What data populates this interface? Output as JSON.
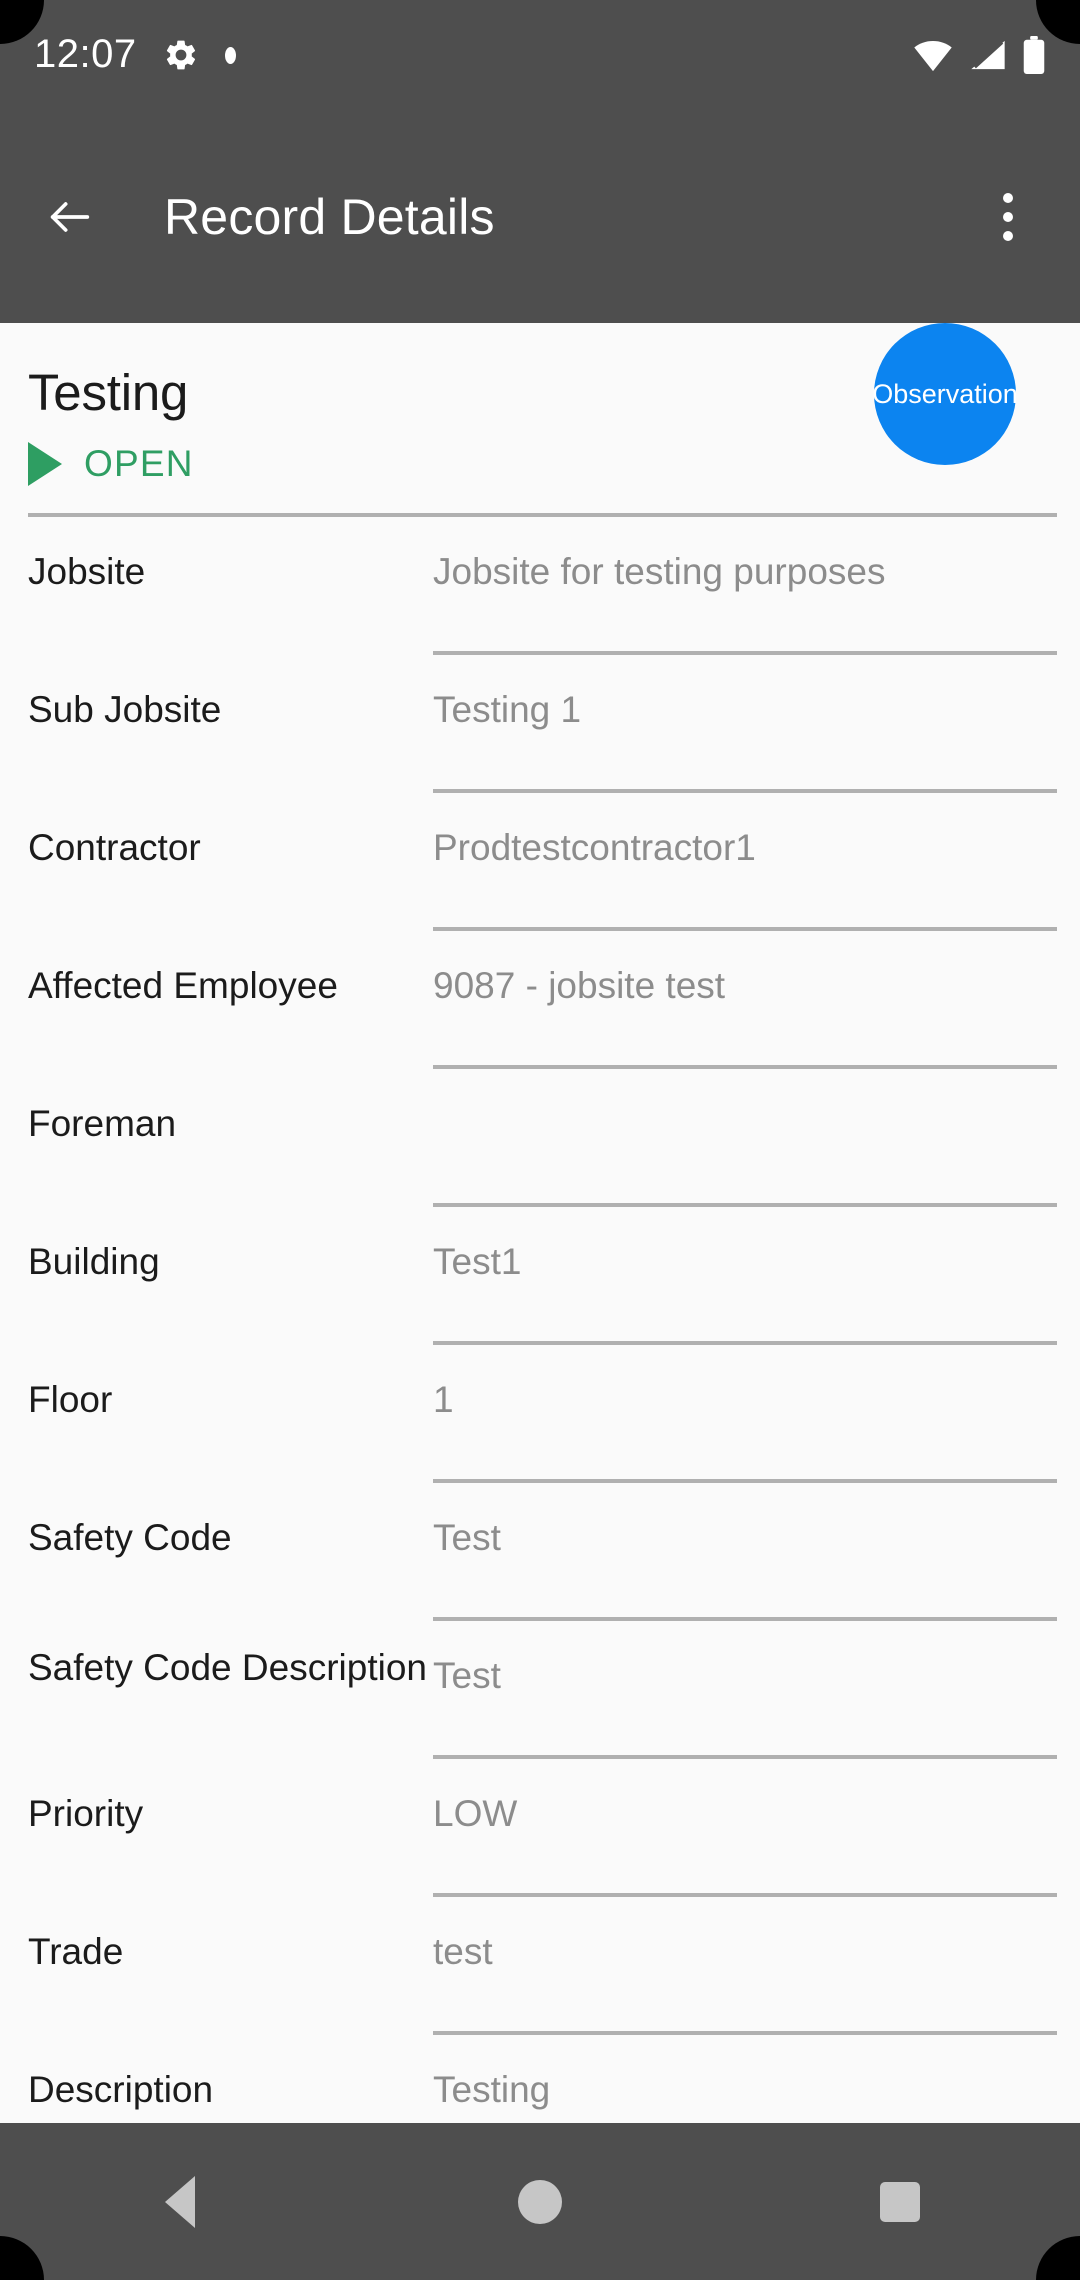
{
  "status_bar": {
    "time": "12:07",
    "icons_left": [
      "gear-icon",
      "dot-icon"
    ],
    "icons_right": [
      "wifi-icon",
      "cell-signal-icon",
      "battery-icon"
    ]
  },
  "app_bar": {
    "back_label": "Back",
    "title": "Record Details",
    "overflow_label": "More options"
  },
  "record": {
    "name": "Testing",
    "status": "OPEN",
    "status_color": "#2f9e63",
    "type_badge": "Observation",
    "type_badge_color": "#0c84f0"
  },
  "fields": [
    {
      "label": "Jobsite",
      "value": "Jobsite for testing purposes"
    },
    {
      "label": "Sub Jobsite",
      "value": "Testing 1"
    },
    {
      "label": "Contractor",
      "value": "Prodtestcontractor1"
    },
    {
      "label": "Affected Employee",
      "value": "9087 - jobsite test"
    },
    {
      "label": "Foreman",
      "value": ""
    },
    {
      "label": "Building",
      "value": "Test1"
    },
    {
      "label": "Floor",
      "value": "1"
    },
    {
      "label": "Safety Code",
      "value": "Test"
    },
    {
      "label": "Safety Code Description",
      "value": "Test"
    },
    {
      "label": "Priority",
      "value": "LOW"
    },
    {
      "label": "Trade",
      "value": "test"
    },
    {
      "label": "Description",
      "value": "Testing"
    }
  ],
  "nav_bar": {
    "back_label": "Back",
    "home_label": "Home",
    "recents_label": "Recent apps"
  }
}
